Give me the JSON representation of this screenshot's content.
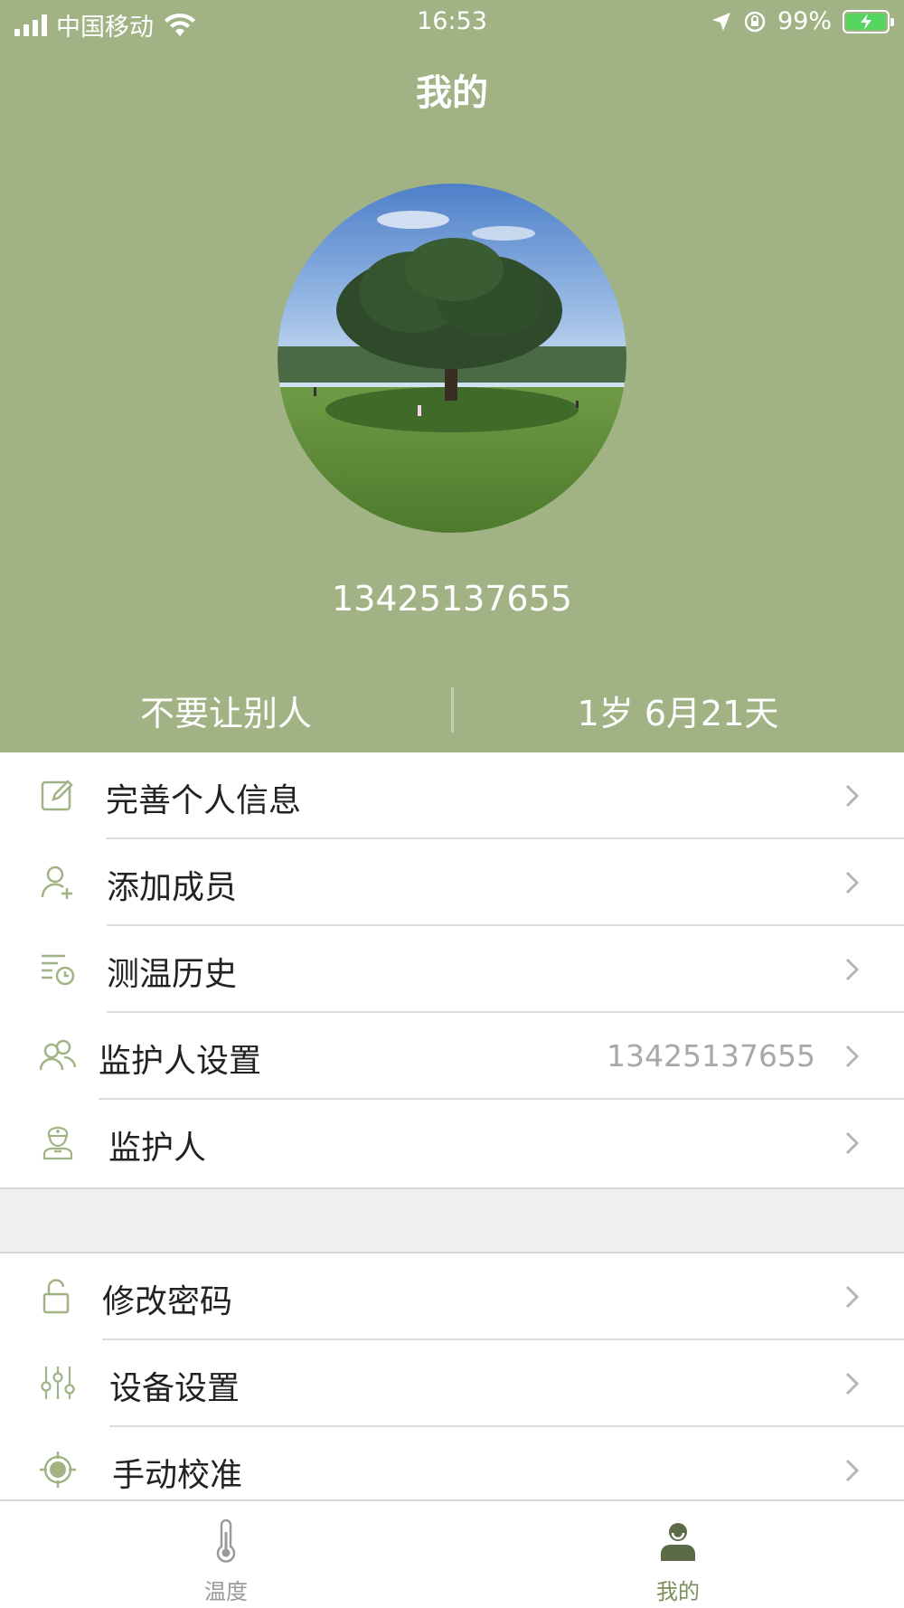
{
  "status_bar": {
    "carrier": "中国移动",
    "time": "16:53",
    "battery": "99%"
  },
  "header": {
    "title": "我的",
    "phone": "13425137655",
    "stat_left": "不要让别人",
    "stat_right": "1岁 6月21天"
  },
  "menu_group_1": [
    {
      "label": "完善个人信息",
      "value": "",
      "icon": "edit-icon"
    },
    {
      "label": "添加成员",
      "value": "",
      "icon": "add-user-icon"
    },
    {
      "label": "测温历史",
      "value": "",
      "icon": "history-icon"
    },
    {
      "label": "监护人设置",
      "value": "13425137655",
      "icon": "users-icon"
    },
    {
      "label": "监护人",
      "value": "",
      "icon": "nurse-icon"
    }
  ],
  "menu_group_2": [
    {
      "label": "修改密码",
      "value": "",
      "icon": "lock-icon"
    },
    {
      "label": "设备设置",
      "value": "",
      "icon": "sliders-icon"
    },
    {
      "label": "手动校准",
      "value": "",
      "icon": "target-icon"
    }
  ],
  "tabbar": {
    "tabs": [
      {
        "label": "温度",
        "icon": "thermometer-icon",
        "active": false
      },
      {
        "label": "我的",
        "icon": "profile-icon",
        "active": true
      }
    ]
  },
  "colors": {
    "header_bg": "#a1b385",
    "accent": "#a1b385",
    "active_tab": "#7a8e5e",
    "inactive_tab": "#9a9a9a",
    "icon": "#a1b385"
  }
}
